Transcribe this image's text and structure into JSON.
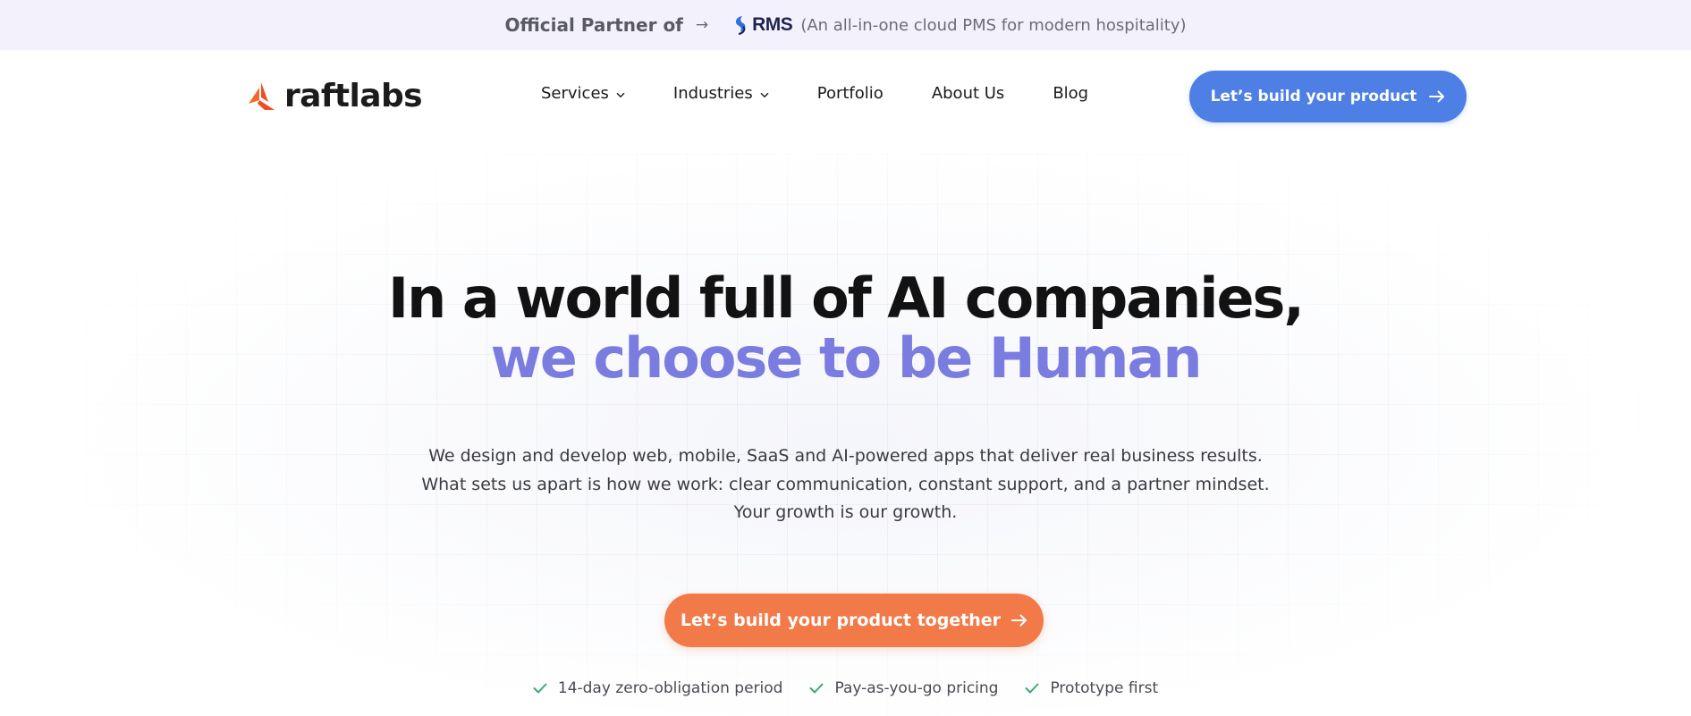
{
  "announcement": {
    "lead": "Official Partner of",
    "arrow_icon": "arrow-right-icon",
    "partner_logo_text": "RMS",
    "tagline": "(An all-in-one cloud PMS for modern hospitality)"
  },
  "header": {
    "brand": "raftlabs",
    "nav": [
      {
        "label": "Services",
        "has_dropdown": true
      },
      {
        "label": "Industries",
        "has_dropdown": true
      },
      {
        "label": "Portfolio",
        "has_dropdown": false
      },
      {
        "label": "About Us",
        "has_dropdown": false
      },
      {
        "label": "Blog",
        "has_dropdown": false
      }
    ],
    "cta_label": "Let’s build your product"
  },
  "hero": {
    "headline_line1": "In a world full of AI companies,",
    "headline_line2": "we choose to be Human",
    "subcopy": [
      "We design and develop web, mobile, SaaS and AI-powered apps that deliver real business results.",
      "What sets us apart is how we work: clear communication, constant support, and a partner mindset.",
      "Your growth is our growth."
    ],
    "cta_label": "Let’s build your product together",
    "features": [
      "14-day zero-obligation period",
      "Pay-as-you-go pricing",
      "Prototype first"
    ]
  },
  "colors": {
    "announcement_bg": "#f3f2fc",
    "primary_blue": "#4d7fe4",
    "accent_orange": "#f27a48",
    "headline_accent": "#7a7cdf",
    "check_green": "#3bab6e",
    "brand_orange": "#ef4d24"
  }
}
